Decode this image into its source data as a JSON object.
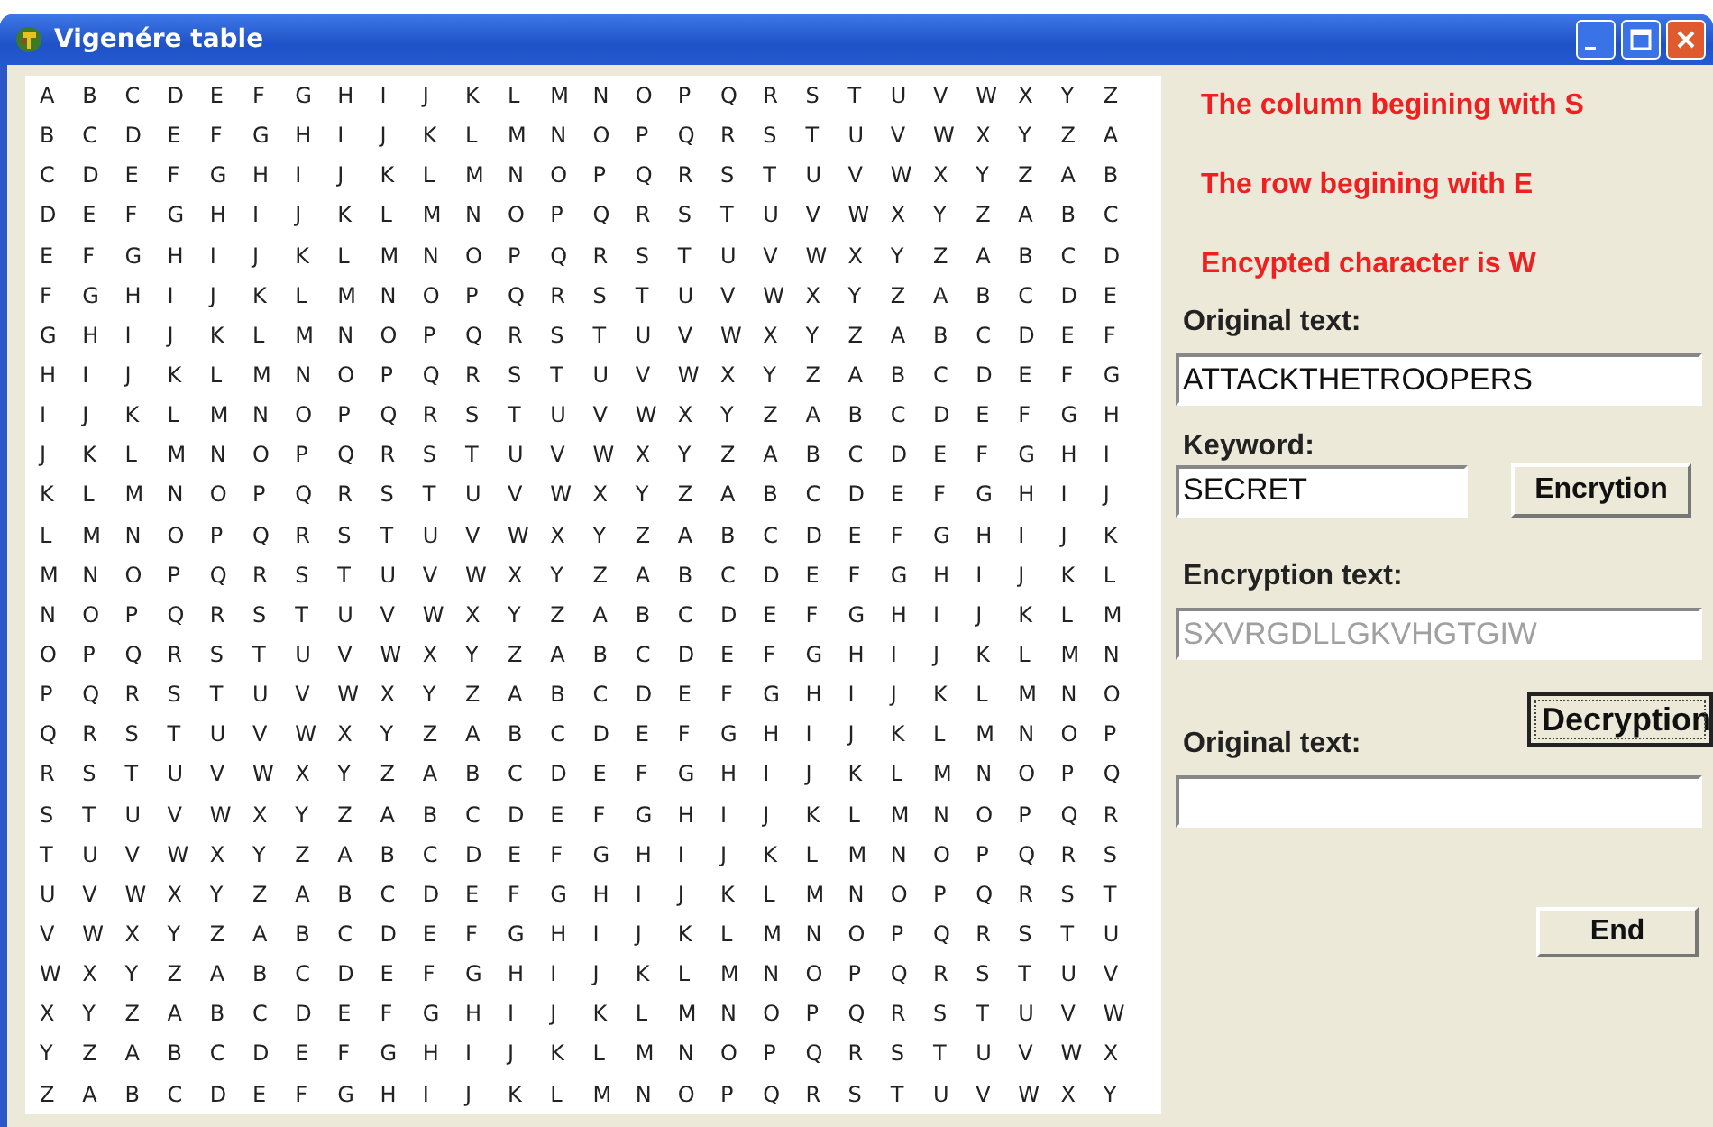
{
  "window": {
    "title": "Vigenére table"
  },
  "table": {
    "rows": [
      [
        "A",
        "B",
        "C",
        "D",
        "E",
        "F",
        "G",
        "H",
        "I",
        "J",
        "K",
        "L",
        "M",
        "N",
        "O",
        "P",
        "Q",
        "R",
        "S",
        "T",
        "U",
        "V",
        "W",
        "X",
        "Y",
        "Z"
      ],
      [
        "B",
        "C",
        "D",
        "E",
        "F",
        "G",
        "H",
        "I",
        "J",
        "K",
        "L",
        "M",
        "N",
        "O",
        "P",
        "Q",
        "R",
        "S",
        "T",
        "U",
        "V",
        "W",
        "X",
        "Y",
        "Z",
        "A"
      ],
      [
        "C",
        "D",
        "E",
        "F",
        "G",
        "H",
        "I",
        "J",
        "K",
        "L",
        "M",
        "N",
        "O",
        "P",
        "Q",
        "R",
        "S",
        "T",
        "U",
        "V",
        "W",
        "X",
        "Y",
        "Z",
        "A",
        "B"
      ],
      [
        "D",
        "E",
        "F",
        "G",
        "H",
        "I",
        "J",
        "K",
        "L",
        "M",
        "N",
        "O",
        "P",
        "Q",
        "R",
        "S",
        "T",
        "U",
        "V",
        "W",
        "X",
        "Y",
        "Z",
        "A",
        "B",
        "C"
      ],
      [
        "E",
        "F",
        "G",
        "H",
        "I",
        "J",
        "K",
        "L",
        "M",
        "N",
        "O",
        "P",
        "Q",
        "R",
        "S",
        "T",
        "U",
        "V",
        "W",
        "X",
        "Y",
        "Z",
        "A",
        "B",
        "C",
        "D"
      ],
      [
        "F",
        "G",
        "H",
        "I",
        "J",
        "K",
        "L",
        "M",
        "N",
        "O",
        "P",
        "Q",
        "R",
        "S",
        "T",
        "U",
        "V",
        "W",
        "X",
        "Y",
        "Z",
        "A",
        "B",
        "C",
        "D",
        "E"
      ],
      [
        "G",
        "H",
        "I",
        "J",
        "K",
        "L",
        "M",
        "N",
        "O",
        "P",
        "Q",
        "R",
        "S",
        "T",
        "U",
        "V",
        "W",
        "X",
        "Y",
        "Z",
        "A",
        "B",
        "C",
        "D",
        "E",
        "F"
      ],
      [
        "H",
        "I",
        "J",
        "K",
        "L",
        "M",
        "N",
        "O",
        "P",
        "Q",
        "R",
        "S",
        "T",
        "U",
        "V",
        "W",
        "X",
        "Y",
        "Z",
        "A",
        "B",
        "C",
        "D",
        "E",
        "F",
        "G"
      ],
      [
        "I",
        "J",
        "K",
        "L",
        "M",
        "N",
        "O",
        "P",
        "Q",
        "R",
        "S",
        "T",
        "U",
        "V",
        "W",
        "X",
        "Y",
        "Z",
        "A",
        "B",
        "C",
        "D",
        "E",
        "F",
        "G",
        "H"
      ],
      [
        "J",
        "K",
        "L",
        "M",
        "N",
        "O",
        "P",
        "Q",
        "R",
        "S",
        "T",
        "U",
        "V",
        "W",
        "X",
        "Y",
        "Z",
        "A",
        "B",
        "C",
        "D",
        "E",
        "F",
        "G",
        "H",
        "I"
      ],
      [
        "K",
        "L",
        "M",
        "N",
        "O",
        "P",
        "Q",
        "R",
        "S",
        "T",
        "U",
        "V",
        "W",
        "X",
        "Y",
        "Z",
        "A",
        "B",
        "C",
        "D",
        "E",
        "F",
        "G",
        "H",
        "I",
        "J"
      ],
      [
        "L",
        "M",
        "N",
        "O",
        "P",
        "Q",
        "R",
        "S",
        "T",
        "U",
        "V",
        "W",
        "X",
        "Y",
        "Z",
        "A",
        "B",
        "C",
        "D",
        "E",
        "F",
        "G",
        "H",
        "I",
        "J",
        "K"
      ],
      [
        "M",
        "N",
        "O",
        "P",
        "Q",
        "R",
        "S",
        "T",
        "U",
        "V",
        "W",
        "X",
        "Y",
        "Z",
        "A",
        "B",
        "C",
        "D",
        "E",
        "F",
        "G",
        "H",
        "I",
        "J",
        "K",
        "L"
      ],
      [
        "N",
        "O",
        "P",
        "Q",
        "R",
        "S",
        "T",
        "U",
        "V",
        "W",
        "X",
        "Y",
        "Z",
        "A",
        "B",
        "C",
        "D",
        "E",
        "F",
        "G",
        "H",
        "I",
        "J",
        "K",
        "L",
        "M"
      ],
      [
        "O",
        "P",
        "Q",
        "R",
        "S",
        "T",
        "U",
        "V",
        "W",
        "X",
        "Y",
        "Z",
        "A",
        "B",
        "C",
        "D",
        "E",
        "F",
        "G",
        "H",
        "I",
        "J",
        "K",
        "L",
        "M",
        "N"
      ],
      [
        "P",
        "Q",
        "R",
        "S",
        "T",
        "U",
        "V",
        "W",
        "X",
        "Y",
        "Z",
        "A",
        "B",
        "C",
        "D",
        "E",
        "F",
        "G",
        "H",
        "I",
        "J",
        "K",
        "L",
        "M",
        "N",
        "O"
      ],
      [
        "Q",
        "R",
        "S",
        "T",
        "U",
        "V",
        "W",
        "X",
        "Y",
        "Z",
        "A",
        "B",
        "C",
        "D",
        "E",
        "F",
        "G",
        "H",
        "I",
        "J",
        "K",
        "L",
        "M",
        "N",
        "O",
        "P"
      ],
      [
        "R",
        "S",
        "T",
        "U",
        "V",
        "W",
        "X",
        "Y",
        "Z",
        "A",
        "B",
        "C",
        "D",
        "E",
        "F",
        "G",
        "H",
        "I",
        "J",
        "K",
        "L",
        "M",
        "N",
        "O",
        "P",
        "Q"
      ],
      [
        "S",
        "T",
        "U",
        "V",
        "W",
        "X",
        "Y",
        "Z",
        "A",
        "B",
        "C",
        "D",
        "E",
        "F",
        "G",
        "H",
        "I",
        "J",
        "K",
        "L",
        "M",
        "N",
        "O",
        "P",
        "Q",
        "R"
      ],
      [
        "T",
        "U",
        "V",
        "W",
        "X",
        "Y",
        "Z",
        "A",
        "B",
        "C",
        "D",
        "E",
        "F",
        "G",
        "H",
        "I",
        "J",
        "K",
        "L",
        "M",
        "N",
        "O",
        "P",
        "Q",
        "R",
        "S"
      ],
      [
        "U",
        "V",
        "W",
        "X",
        "Y",
        "Z",
        "A",
        "B",
        "C",
        "D",
        "E",
        "F",
        "G",
        "H",
        "I",
        "J",
        "K",
        "L",
        "M",
        "N",
        "O",
        "P",
        "Q",
        "R",
        "S",
        "T"
      ],
      [
        "V",
        "W",
        "X",
        "Y",
        "Z",
        "A",
        "B",
        "C",
        "D",
        "E",
        "F",
        "G",
        "H",
        "I",
        "J",
        "K",
        "L",
        "M",
        "N",
        "O",
        "P",
        "Q",
        "R",
        "S",
        "T",
        "U"
      ],
      [
        "W",
        "X",
        "Y",
        "Z",
        "A",
        "B",
        "C",
        "D",
        "E",
        "F",
        "G",
        "H",
        "I",
        "J",
        "K",
        "L",
        "M",
        "N",
        "O",
        "P",
        "Q",
        "R",
        "S",
        "T",
        "U",
        "V"
      ],
      [
        "X",
        "Y",
        "Z",
        "A",
        "B",
        "C",
        "D",
        "E",
        "F",
        "G",
        "H",
        "I",
        "J",
        "K",
        "L",
        "M",
        "N",
        "O",
        "P",
        "Q",
        "R",
        "S",
        "T",
        "U",
        "V",
        "W"
      ],
      [
        "Y",
        "Z",
        "A",
        "B",
        "C",
        "D",
        "E",
        "F",
        "G",
        "H",
        "I",
        "J",
        "K",
        "L",
        "M",
        "N",
        "O",
        "P",
        "Q",
        "R",
        "S",
        "T",
        "U",
        "V",
        "W",
        "X"
      ],
      [
        "Z",
        "A",
        "B",
        "C",
        "D",
        "E",
        "F",
        "G",
        "H",
        "I",
        "J",
        "K",
        "L",
        "M",
        "N",
        "O",
        "P",
        "Q",
        "R",
        "S",
        "T",
        "U",
        "V",
        "W",
        "X",
        "Y"
      ]
    ]
  },
  "messages": [
    "The column begining with S",
    "The row begining with E",
    "Encypted character is W"
  ],
  "original_text": {
    "label": "Original text:",
    "value": "ATTACKTHETROOPERS",
    "disabled": false
  },
  "keyword": {
    "label": "Keyword:",
    "value": "SECRET",
    "disabled": false
  },
  "encryption_button": {
    "label": "Encrytion",
    "focused": false
  },
  "encryption_text": {
    "label": "Encryption text:",
    "value": "SXVRGDLLGKVHGTGIW",
    "disabled": true
  },
  "decryption_button": {
    "label": "Decryption",
    "focused": true
  },
  "decrypted_text": {
    "label": "Original text:"
  },
  "end_button": {
    "label": "End",
    "focused": false
  }
}
